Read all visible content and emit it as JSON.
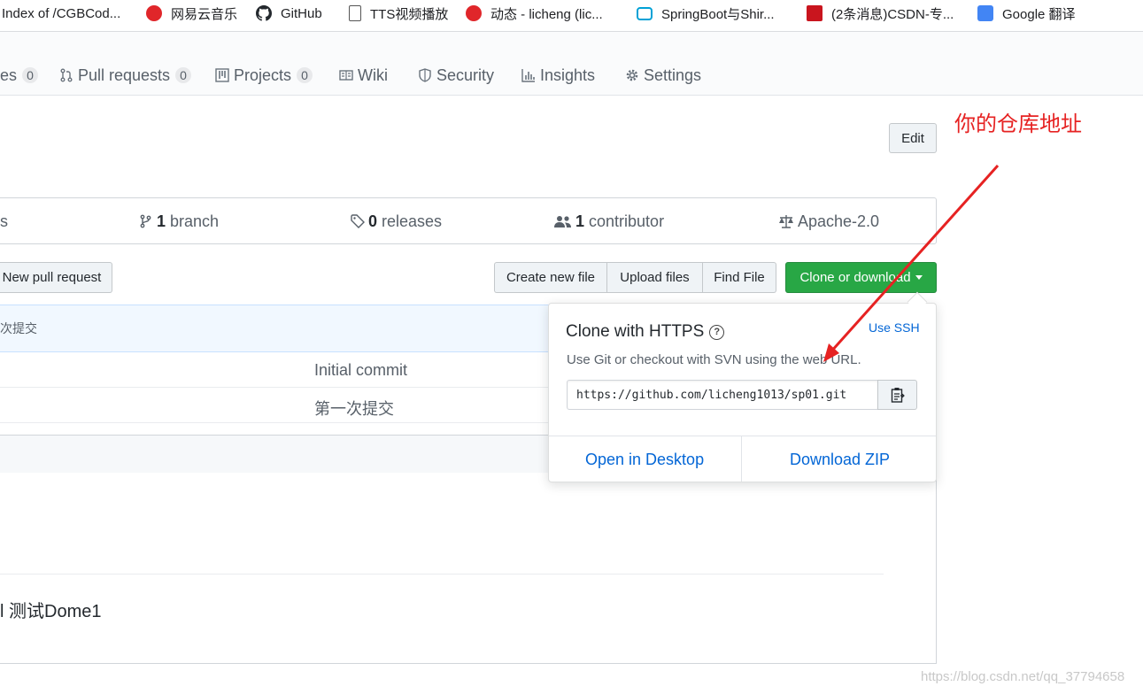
{
  "bookmarks": [
    {
      "label": "Index of /CGBCod...",
      "icon": "page-icon"
    },
    {
      "label": "网易云音乐",
      "icon": "netease-music-icon"
    },
    {
      "label": "GitHub",
      "icon": "github-icon"
    },
    {
      "label": "TTS视频播放",
      "icon": "document-icon"
    },
    {
      "label": "动态 - licheng (lic...",
      "icon": "g-logo-icon"
    },
    {
      "label": "SpringBoot与Shir...",
      "icon": "bilibili-tv-icon"
    },
    {
      "label": "(2条消息)CSDN-专...",
      "icon": "csdn-icon"
    },
    {
      "label": "Google 翻译",
      "icon": "google-translate-icon"
    }
  ],
  "nav": {
    "issues": {
      "label": "es",
      "count": "0"
    },
    "pulls": {
      "label": "Pull requests",
      "count": "0"
    },
    "projects": {
      "label": "Projects",
      "count": "0"
    },
    "wiki": {
      "label": "Wiki"
    },
    "security": {
      "label": "Security"
    },
    "insights": {
      "label": "Insights"
    },
    "settings": {
      "label": "Settings"
    }
  },
  "edit_label": "Edit",
  "annotation": "你的仓库地址",
  "summary": {
    "commits_tail": "s",
    "branch_count": "1",
    "branch_label": "branch",
    "release_count": "0",
    "release_label": "releases",
    "contributor_count": "1",
    "contributor_label": "contributor",
    "license": "Apache-2.0"
  },
  "buttons": {
    "new_pull": "New pull request",
    "create_file": "Create new file",
    "upload": "Upload files",
    "find": "Find File",
    "clone": "Clone or download"
  },
  "files": {
    "latest_commit": "次提交",
    "rows": [
      {
        "message": "Initial commit"
      },
      {
        "message": "第一次提交"
      }
    ]
  },
  "readme": {
    "title": "l 测试Dome1"
  },
  "clone": {
    "title": "Clone with HTTPS",
    "use_ssh": "Use SSH",
    "description": "Use Git or checkout with SVN using the web URL.",
    "url": "https://github.com/licheng1013/sp01.git",
    "open_desktop": "Open in Desktop",
    "download_zip": "Download ZIP"
  },
  "watermark": "https://blog.csdn.net/qq_37794658",
  "colors": {
    "annotation": "#e62222",
    "primary_green": "#28a745",
    "link_blue": "#0366d6"
  }
}
